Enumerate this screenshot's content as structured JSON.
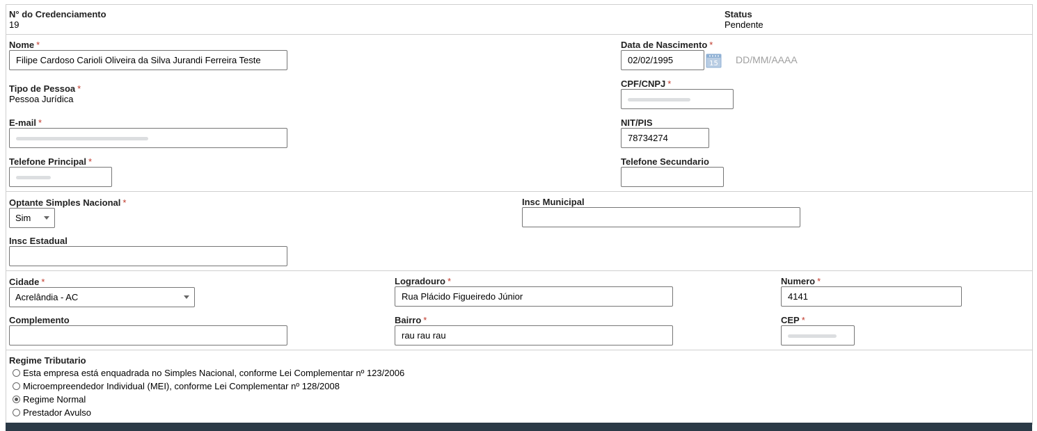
{
  "header": {
    "credenciamento_label": "N° do Credenciamento",
    "credenciamento_value": "19",
    "status_label": "Status",
    "status_value": "Pendente"
  },
  "person": {
    "nome_label": "Nome",
    "nome_value": "Filipe Cardoso Carioli Oliveira da Silva Jurandi Ferreira Teste",
    "nascimento_label": "Data de Nascimento",
    "nascimento_value": "02/02/1995",
    "nascimento_hint": "DD/MM/AAAA",
    "tipo_pessoa_label": "Tipo de Pessoa",
    "tipo_pessoa_value": "Pessoa Jurídica",
    "cpf_label": "CPF/CNPJ",
    "cpf_value": "",
    "email_label": "E-mail",
    "email_value": "",
    "nit_label": "NIT/PIS",
    "nit_value": "78734274",
    "tel_principal_label": "Telefone Principal",
    "tel_principal_value": "",
    "tel_secundario_label": "Telefone Secundario",
    "tel_secundario_value": ""
  },
  "fiscal": {
    "simples_label": "Optante Simples Nacional",
    "simples_value": "Sim",
    "insc_municipal_label": "Insc Municipal",
    "insc_municipal_value": "",
    "insc_estadual_label": "Insc Estadual",
    "insc_estadual_value": ""
  },
  "address": {
    "cidade_label": "Cidade",
    "cidade_value": "Acrelândia - AC",
    "logradouro_label": "Logradouro",
    "logradouro_value": "Rua Plácido Figueiredo Júnior",
    "numero_label": "Numero",
    "numero_value": "4141",
    "complemento_label": "Complemento",
    "complemento_value": "",
    "bairro_label": "Bairro",
    "bairro_value": "rau rau rau",
    "cep_label": "CEP",
    "cep_value": ""
  },
  "regime": {
    "label": "Regime Tributario",
    "options": [
      {
        "label": "Esta empresa está enquadrada no Simples Nacional, conforme Lei Complementar nº 123/2006",
        "checked": false
      },
      {
        "label": "Microempreendedor Individual (MEI), conforme Lei Complementar nº 128/2008",
        "checked": false
      },
      {
        "label": "Regime Normal",
        "checked": true
      },
      {
        "label": "Prestador Avulso",
        "checked": false
      }
    ]
  },
  "required_mark": "*",
  "icons": {
    "calendar": "calendar-icon",
    "dropdown": "chevron-down-icon"
  },
  "colors": {
    "required": "#c0392b",
    "bottom_bar": "#2b3a47",
    "border": "#cfcfcf"
  }
}
